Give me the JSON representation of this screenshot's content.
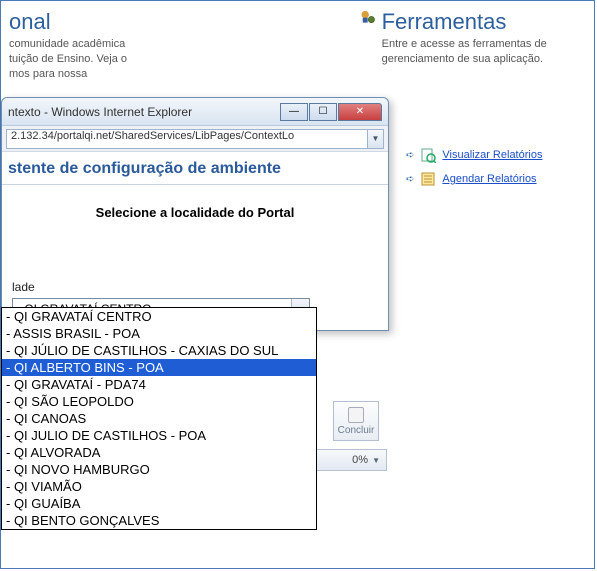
{
  "bg": {
    "left_title": "onal",
    "left_desc_1": "comunidade acadêmica",
    "left_desc_2": "tuição de Ensino. Veja o",
    "left_desc_3": "mos para nossa",
    "right_title": "Ferramentas",
    "right_desc": "Entre e acesse as ferramentas de gerenciamento de sua aplicação."
  },
  "tools": {
    "link1": "Visualizar Relatórios",
    "link2": "Agendar Relatórios"
  },
  "popup": {
    "title": "ntexto - Windows Internet Explorer",
    "url": "2.132.34/portalqi.net/SharedServices/LibPages/ContextLo",
    "header": "stente de configuração de ambiente",
    "body_title": "Selecione a localidade do Portal",
    "field_label": "lade",
    "selected_option": "- QI GRAVATAÍ CENTRO",
    "options": [
      "- QI GRAVATAÍ CENTRO",
      "- ASSIS BRASIL - POA",
      "- QI JÚLIO DE CASTILHOS - CAXIAS DO SUL",
      "- QI ALBERTO BINS - POA",
      "- QI GRAVATAÍ - PDA74",
      "- QI SÃO LEOPOLDO",
      "- QI CANOAS",
      "- QI JULIO DE CASTILHOS - POA",
      "- QI ALVORADA",
      "- QI NOVO HAMBURGO",
      "- QI VIAMÃO",
      "- QI GUAÍBA",
      "- QI BENTO GONÇALVES"
    ],
    "highlighted_index": 3,
    "btn_concluir": "Concluir",
    "zoom": "0%"
  }
}
